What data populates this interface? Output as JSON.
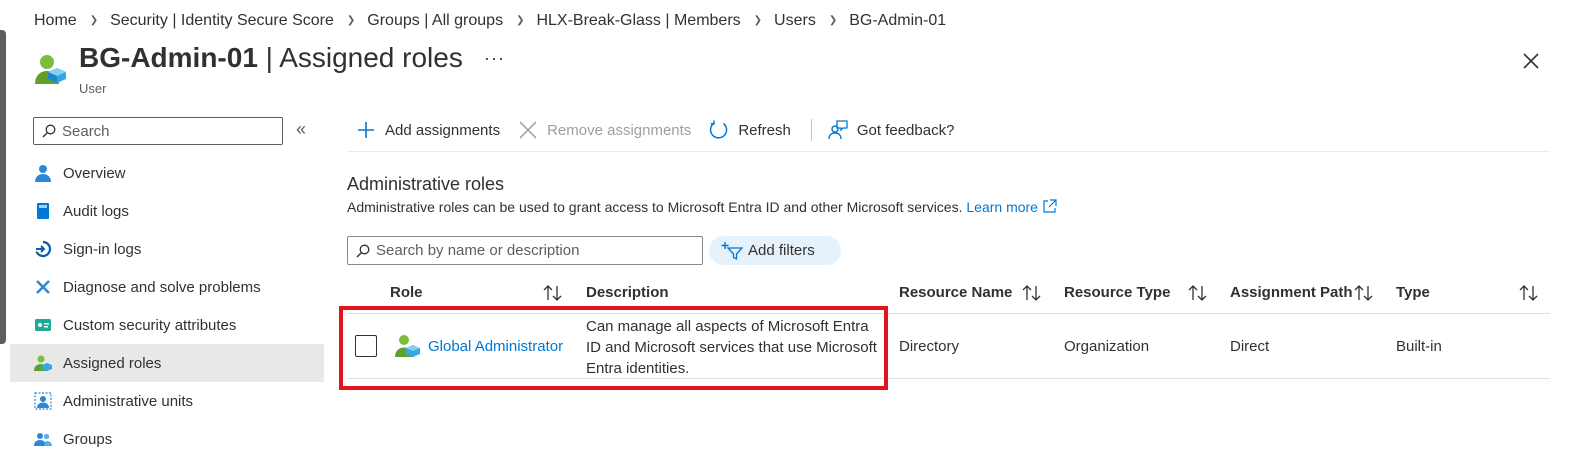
{
  "breadcrumb": [
    "Home",
    "Security | Identity Secure Score",
    "Groups | All groups",
    "HLX-Break-Glass | Members",
    "Users",
    "BG-Admin-01"
  ],
  "header": {
    "title_name": "BG-Admin-01",
    "title_rest": " | Assigned roles",
    "subtitle": "User",
    "more_label": "···"
  },
  "sidebar": {
    "search_placeholder": "Search",
    "collapse_label": "«",
    "items": [
      {
        "label": "Overview",
        "icon": "user-icon"
      },
      {
        "label": "Audit logs",
        "icon": "book-icon"
      },
      {
        "label": "Sign-in logs",
        "icon": "sign-in-icon"
      },
      {
        "label": "Diagnose and solve problems",
        "icon": "wrench-icon"
      },
      {
        "label": "Custom security attributes",
        "icon": "tag-icon"
      },
      {
        "label": "Assigned roles",
        "icon": "user-role-icon",
        "active": true
      },
      {
        "label": "Administrative units",
        "icon": "admin-units-icon"
      },
      {
        "label": "Groups",
        "icon": "group-icon"
      }
    ]
  },
  "toolbar": {
    "add_label": "Add assignments",
    "remove_label": "Remove assignments",
    "refresh_label": "Refresh",
    "feedback_label": "Got feedback?"
  },
  "section": {
    "title": "Administrative roles",
    "description": "Administrative roles can be used to grant access to Microsoft Entra ID and other Microsoft services. ",
    "learn_more": "Learn more"
  },
  "filters": {
    "search_placeholder": "Search by name or description",
    "add_filters_label": "Add filters"
  },
  "table": {
    "columns": [
      "Role",
      "Description",
      "Resource Name",
      "Resource Type",
      "Assignment Path",
      "Type"
    ],
    "rows": [
      {
        "role": "Global Administrator",
        "description": "Can manage all aspects of Microsoft Entra ID and Microsoft services that use Microsoft Entra identities.",
        "resource_name": "Directory",
        "resource_type": "Organization",
        "assignment_path": "Direct",
        "type": "Built-in"
      }
    ]
  },
  "colors": {
    "accent": "#0078d4",
    "highlight": "#e2141c",
    "active_nav_bg": "#e8e8e8",
    "filter_pill_bg": "#e5f1fb"
  }
}
